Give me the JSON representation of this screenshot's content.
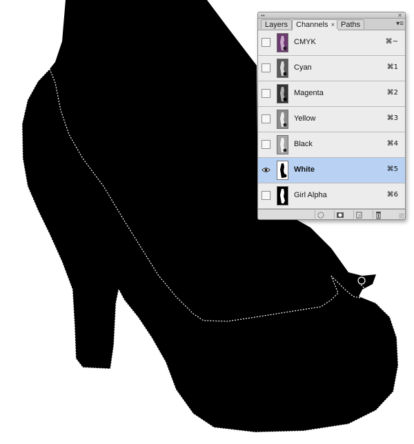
{
  "tabs": [
    {
      "label": "Layers",
      "active": false
    },
    {
      "label": "Channels",
      "active": true
    },
    {
      "label": "Paths",
      "active": false
    }
  ],
  "tab_close_glyph": "×",
  "panel_menu_glyph": "▾≡",
  "channels": [
    {
      "name": "CMYK",
      "shortcut": "⌘~",
      "visible": false,
      "selected": false,
      "thumb": "cmyk-thumbnail"
    },
    {
      "name": "Cyan",
      "shortcut": "⌘1",
      "visible": false,
      "selected": false,
      "thumb": "gray-thumbnail"
    },
    {
      "name": "Magenta",
      "shortcut": "⌘2",
      "visible": false,
      "selected": false,
      "thumb": "dark-thumbnail"
    },
    {
      "name": "Yellow",
      "shortcut": "⌘3",
      "visible": false,
      "selected": false,
      "thumb": "light-thumbnail"
    },
    {
      "name": "Black",
      "shortcut": "⌘4",
      "visible": false,
      "selected": false,
      "thumb": "light-thumbnail"
    },
    {
      "name": "White",
      "shortcut": "⌘5",
      "visible": true,
      "selected": true,
      "thumb": "white-silhouette-thumbnail"
    },
    {
      "name": "Girl Alpha",
      "shortcut": "⌘6",
      "visible": false,
      "selected": false,
      "thumb": "alpha-thumbnail"
    }
  ],
  "bottom_icons": [
    "load-selection-icon",
    "save-selection-icon",
    "new-channel-icon",
    "delete-channel-icon"
  ],
  "colors": {
    "selection_highlight": "#b9d2f4",
    "canvas_fill": "#000000",
    "marching_ants": "#ffffff"
  }
}
